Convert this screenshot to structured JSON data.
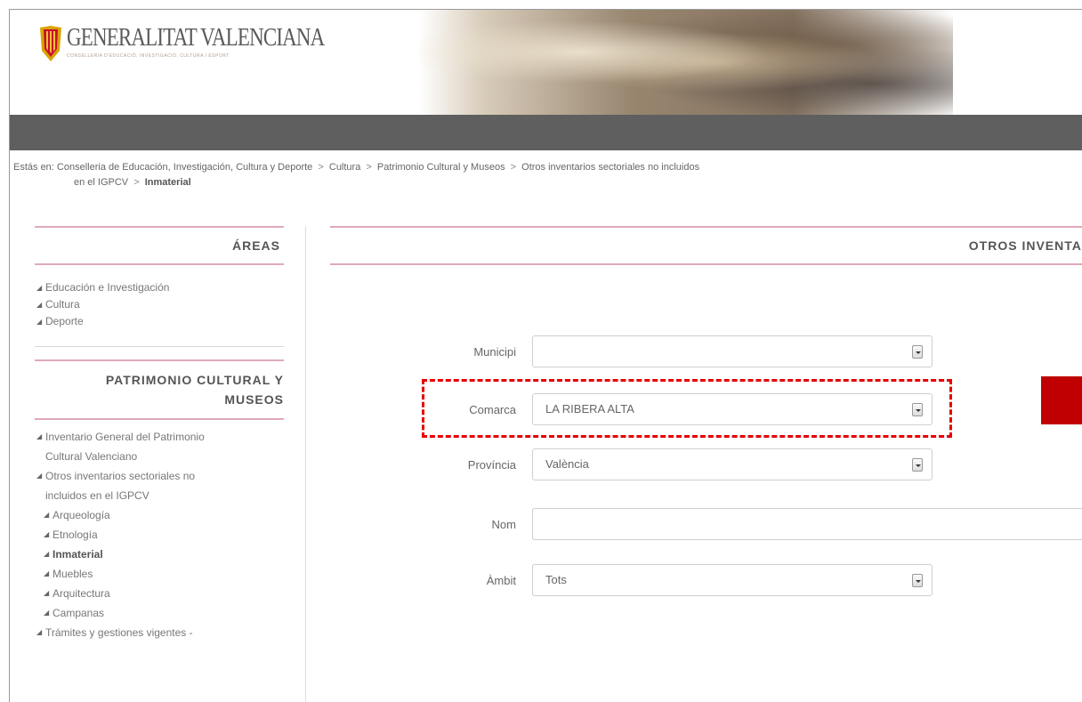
{
  "header": {
    "logo_title": "GENERALITAT VALENCIANA",
    "logo_subtitle": "CONSELLERIA D'EDUCACIÓ, INVESTIGACIÓ, CULTURA I ESPORT"
  },
  "breadcrumb": {
    "prefix": "Estás en:",
    "sep": ">",
    "items": [
      "Conselleria de Educación, Investigación, Cultura y Deporte",
      "Cultura",
      "Patrimonio Cultural y Museos",
      "Otros inventarios sectoriales no incluidos",
      "en el IGPCV",
      "Inmaterial"
    ]
  },
  "sidebar": {
    "areas_title": "ÁREAS",
    "areas": [
      "Educación e Investigación",
      "Cultura",
      "Deporte"
    ],
    "pcm_title_1": "PATRIMONIO CULTURAL Y",
    "pcm_title_2": "MUSEOS",
    "pcm_items": [
      "Inventario General del Patrimonio",
      "Cultural Valenciano",
      "Otros inventarios sectoriales no",
      "incluidos en el IGPCV",
      "Arqueología",
      "Etnología",
      "Inmaterial",
      "Muebles",
      "Arquitectura",
      "Campanas",
      "Trámites y gestiones vigentes -"
    ]
  },
  "main": {
    "title": "OTROS INVENTAR",
    "form": {
      "municipi_label": "Municipi",
      "municipi_value": "",
      "comarca_label": "Comarca",
      "comarca_value": "LA RIBERA ALTA",
      "provincia_label": "Província",
      "provincia_value": "València",
      "nom_label": "Nom",
      "nom_value": "",
      "ambit_label": "Àmbit",
      "ambit_value": "Tots"
    }
  },
  "colors": {
    "accent_pink": "#e0aab8",
    "dark_bar": "#5f5f5f",
    "highlight_red": "#e60000",
    "button_red": "#c00000"
  }
}
